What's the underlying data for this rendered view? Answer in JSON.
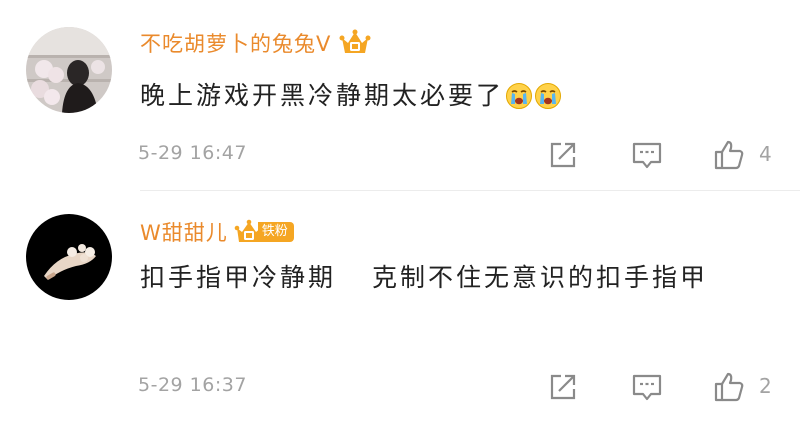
{
  "comments": [
    {
      "username": "不吃胡萝卜的兔兔V",
      "badge": "crown-badge",
      "text": "晚上游戏开黑冷静期太必要了",
      "emojis": [
        "crying-emoji",
        "crying-emoji"
      ],
      "timestamp": "5-29 16:47",
      "like_count": "4"
    },
    {
      "username": "W甜甜儿",
      "badge_label": "铁粉",
      "text_part1": "扣手指甲冷静期",
      "text_part2": "克制不住无意识的扣手指甲",
      "timestamp": "5-29 16:37",
      "like_count": "2"
    }
  ],
  "colors": {
    "username": "#ea8a2c",
    "badge_gold": "#f5a623",
    "meta_gray": "#a3a3a3",
    "text": "#222222"
  },
  "icons": [
    "share-icon",
    "comment-icon",
    "like-icon"
  ]
}
